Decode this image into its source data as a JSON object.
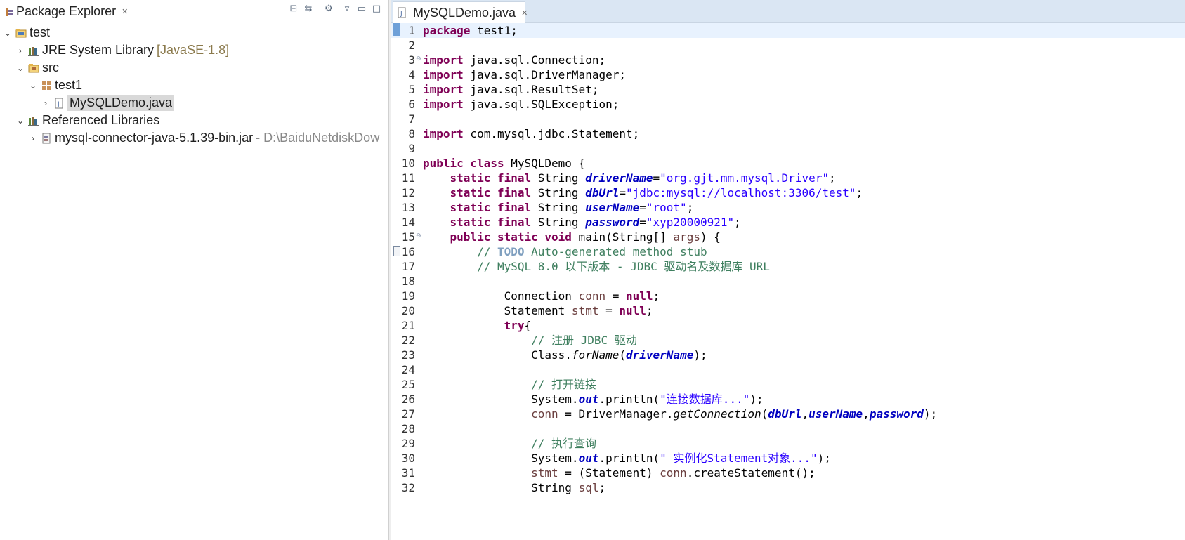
{
  "package_explorer": {
    "tab_title": "Package Explorer",
    "tree": [
      {
        "label": "test",
        "suffix": "",
        "icon": "project-icon",
        "chev": "v"
      },
      {
        "label": "JRE System Library",
        "suffix": "[JavaSE-1.8]",
        "icon": "library-icon",
        "chev": ">"
      },
      {
        "label": "src",
        "suffix": "",
        "icon": "source-folder-icon",
        "chev": "v"
      },
      {
        "label": "test1",
        "suffix": "",
        "icon": "package-icon",
        "chev": "v"
      },
      {
        "label": "MySQLDemo.java",
        "suffix": "",
        "icon": "java-file-icon",
        "chev": ">"
      },
      {
        "label": "Referenced Libraries",
        "suffix": "",
        "icon": "library-icon",
        "chev": "v"
      },
      {
        "label": "mysql-connector-java-5.1.39-bin.jar",
        "suffix": "- D:\\BaiduNetdiskDow",
        "icon": "jar-icon",
        "chev": ">"
      }
    ]
  },
  "editor": {
    "tab_title": "MySQLDemo.java",
    "line_numbers": [
      "1",
      "2",
      "3",
      "4",
      "5",
      "6",
      "7",
      "8",
      "9",
      "10",
      "11",
      "12",
      "13",
      "14",
      "15",
      "16",
      "17",
      "18",
      "19",
      "20",
      "21",
      "22",
      "23",
      "24",
      "25",
      "26",
      "27",
      "28",
      "29",
      "30",
      "31",
      "32"
    ],
    "code": {
      "l1": {
        "kw": "package",
        "rest": " test1;"
      },
      "l3": {
        "kw": "import",
        "rest": " java.sql.Connection;"
      },
      "l4": {
        "kw": "import",
        "rest": " java.sql.DriverManager;"
      },
      "l5": {
        "kw": "import",
        "rest": " java.sql.ResultSet;"
      },
      "l6": {
        "kw": "import",
        "rest": " java.sql.SQLException;"
      },
      "l8": {
        "kw": "import",
        "rest": " com.mysql.jdbc.Statement;"
      },
      "l10": {
        "kw": "public class",
        "rest": " MySQLDemo {"
      },
      "l11": {
        "kw": "static final",
        "type": " String ",
        "field": "driverName",
        "eq": "=",
        "str": "\"org.gjt.mm.mysql.Driver\"",
        "end": ";"
      },
      "l12": {
        "kw": "static final",
        "type": " String ",
        "field": "dbUrl",
        "eq": "=",
        "str": "\"jdbc:mysql://localhost:3306/test\"",
        "end": ";"
      },
      "l13": {
        "kw": "static final",
        "type": " String ",
        "field": "userName",
        "eq": "=",
        "str": "\"root\"",
        "end": ";"
      },
      "l14": {
        "kw": "static final",
        "type": " String ",
        "field": "password",
        "eq": "=",
        "str": "\"xyp20000921\"",
        "end": ";"
      },
      "l15": {
        "kw": "public static void",
        "rest1": " main(String[] ",
        "var": "args",
        "rest2": ") {"
      },
      "l16": {
        "c1": "// ",
        "todo": "TODO",
        "c2": " Auto-generated method stub"
      },
      "l17": {
        "c": "// MySQL 8.0 以下版本 - JDBC 驱动名及数据库 URL"
      },
      "l19": {
        "t": "Connection ",
        "var": "conn",
        "m": " = ",
        "kw": "null",
        "end": ";"
      },
      "l20": {
        "t": "Statement ",
        "var": "stmt",
        "m": " = ",
        "kw": "null",
        "end": ";"
      },
      "l21": {
        "kw": "try",
        "rest": "{"
      },
      "l22": {
        "c": "// 注册 JDBC 驱动"
      },
      "l23": {
        "a": "Class.",
        "i": "forName",
        "b": "(",
        "f": "driverName",
        "end": ");"
      },
      "l25": {
        "c": "// 打开链接"
      },
      "l26": {
        "a": "System.",
        "f": "out",
        "b": ".println(",
        "str": "\"连接数据库...\"",
        "end": ");"
      },
      "l27": {
        "var": "conn",
        "a": " = DriverManager.",
        "i": "getConnection",
        "b": "(",
        "f1": "dbUrl",
        "s1": ",",
        "f2": "userName",
        "s2": ",",
        "f3": "password",
        "end": ");"
      },
      "l29": {
        "c": "// 执行查询"
      },
      "l30": {
        "a": "System.",
        "f": "out",
        "b": ".println(",
        "str": "\" 实例化Statement对象...\"",
        "end": ");"
      },
      "l31": {
        "var": "stmt",
        "a": " = (Statement) ",
        "var2": "conn",
        "b": ".createStatement();"
      },
      "l32": {
        "t": "String ",
        "var": "sql",
        "end": ";"
      }
    }
  },
  "colors": {
    "keyword": "#7f0055",
    "string": "#2a00ff",
    "comment": "#3f7f5f",
    "field": "#0000c0",
    "selection": "#d9d9d9",
    "current_line": "#e8f2fe"
  }
}
